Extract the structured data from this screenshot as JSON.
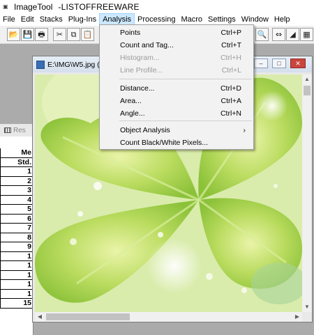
{
  "app": {
    "title": "ImageTool",
    "title_suffix": "-LISTOFFREEWARE"
  },
  "menubar": [
    "File",
    "Edit",
    "Stacks",
    "Plug-Ins",
    "Analysis",
    "Processing",
    "Macro",
    "Settings",
    "Window",
    "Help"
  ],
  "menubar_active": "Analysis",
  "analysis_menu": {
    "items": [
      {
        "label": "Points",
        "shortcut": "Ctrl+P",
        "enabled": true
      },
      {
        "label": "Count and Tag...",
        "shortcut": "Ctrl+T",
        "enabled": true
      },
      {
        "label": "Histogram...",
        "shortcut": "Ctrl+H",
        "enabled": false
      },
      {
        "label": "Line Profile...",
        "shortcut": "Ctrl+L",
        "enabled": false
      },
      {
        "label": "Distance...",
        "shortcut": "Ctrl+D",
        "enabled": true
      },
      {
        "label": "Area...",
        "shortcut": "Ctrl+A",
        "enabled": true
      },
      {
        "label": "Angle...",
        "shortcut": "Ctrl+N",
        "enabled": true
      },
      {
        "label": "Object Analysis",
        "shortcut": "",
        "enabled": true,
        "submenu": true
      },
      {
        "label": "Count Black/White Pixels...",
        "shortcut": "",
        "enabled": true
      }
    ],
    "submenu_arrow": "›"
  },
  "image_window": {
    "title": "E:\\IMG\\W5.jpg (1:"
  },
  "results_window": {
    "title": "Res",
    "header_top": "Me",
    "header_sub": "Std.",
    "rows": [
      "1",
      "2",
      "3",
      "4",
      "5",
      "6",
      "7",
      "8",
      "9",
      "1",
      "1",
      "1",
      "1",
      "1"
    ],
    "last_row": "15"
  },
  "window_controls": {
    "minimize": "–",
    "maximize": "□",
    "close": "✕"
  },
  "scroll_arrows": {
    "up": "▲",
    "down": "▼",
    "left": "◀",
    "right": "▶"
  },
  "toolbar_icons": [
    {
      "name": "open-file-icon",
      "glyph": "📂"
    },
    {
      "name": "save-file-icon",
      "glyph": "💾"
    },
    {
      "name": "print-icon",
      "glyph": "🖶"
    },
    {
      "name": "cut-icon",
      "glyph": "✂"
    },
    {
      "name": "copy-icon",
      "glyph": "⧉"
    },
    {
      "name": "paste-icon",
      "glyph": "📋"
    },
    {
      "name": "zoom-icon",
      "glyph": "🔍"
    },
    {
      "name": "binary-icon",
      "glyph": "⇔"
    },
    {
      "name": "gradient-icon",
      "glyph": "◢"
    },
    {
      "name": "grid-icon",
      "glyph": "▦"
    }
  ],
  "colors": {
    "menu_highlight": "#cce8ff",
    "leaf_green": "#b8d970",
    "close_button": "#c9463d"
  }
}
